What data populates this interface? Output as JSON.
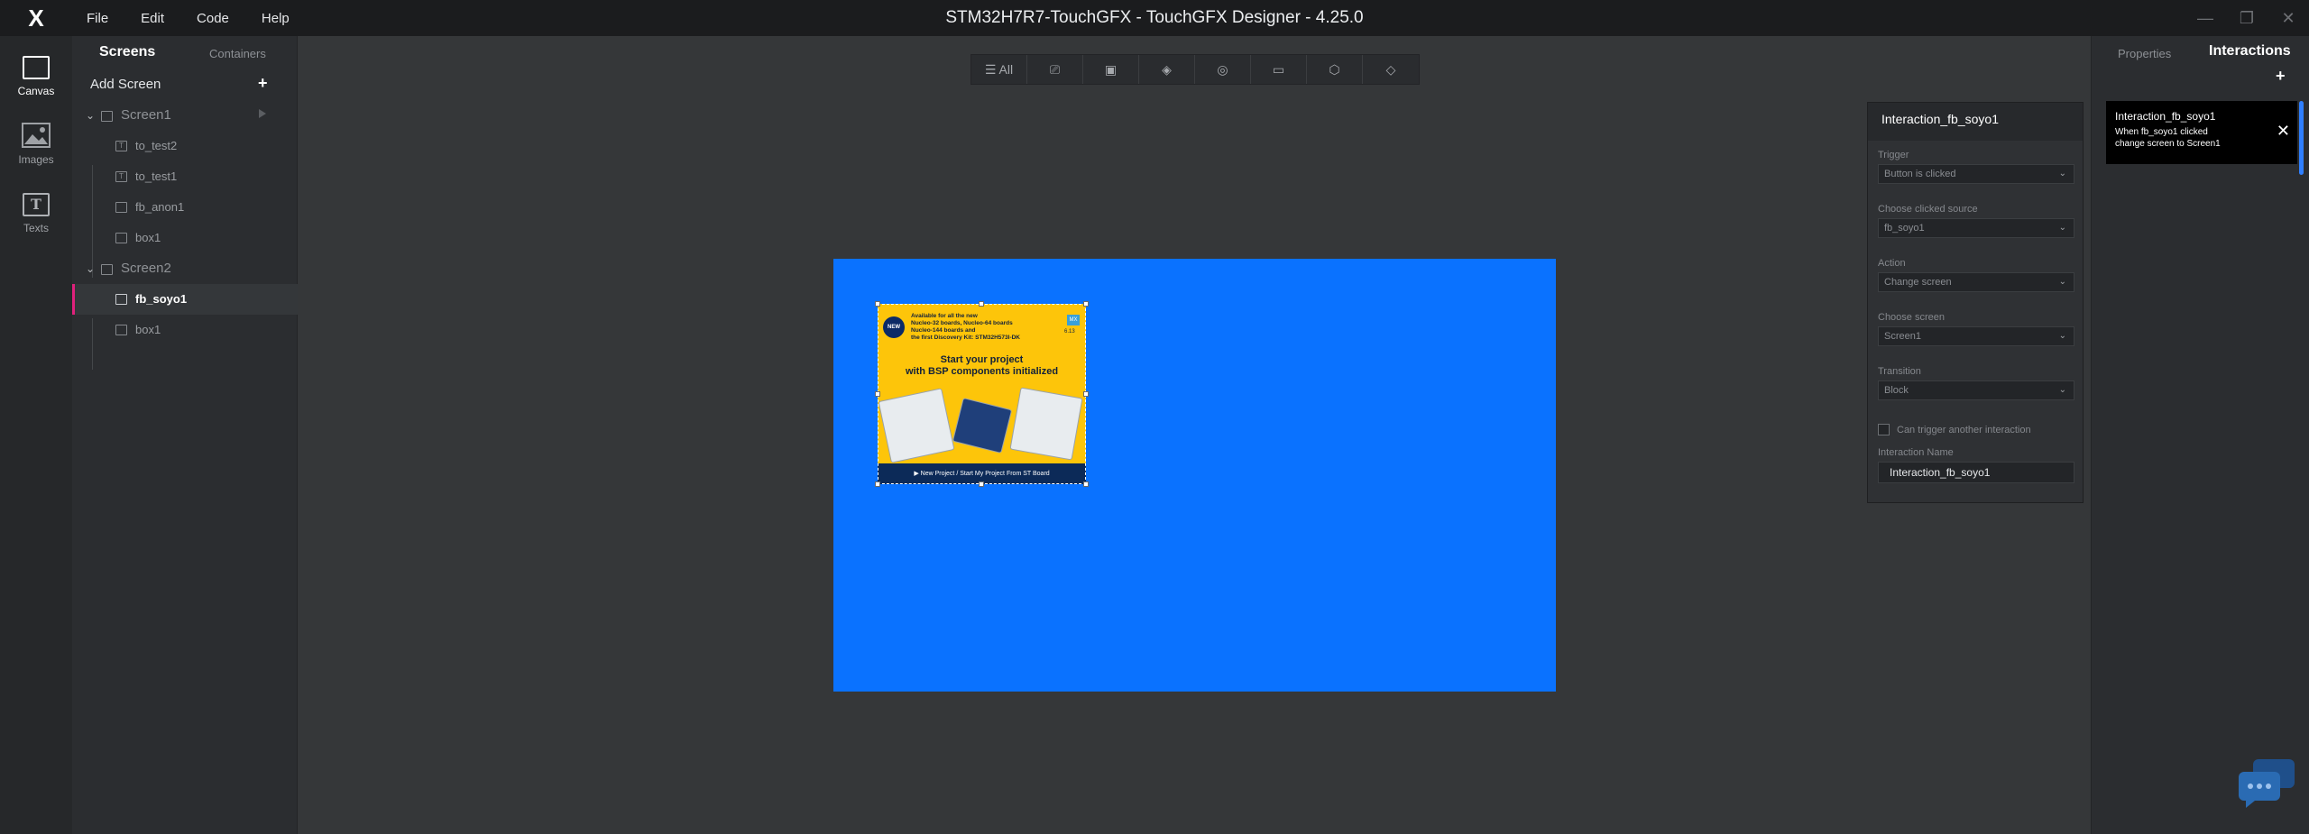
{
  "app": {
    "logo": "X",
    "title": "STM32H7R7-TouchGFX - TouchGFX Designer - 4.25.0",
    "menu": [
      "File",
      "Edit",
      "Code",
      "Help"
    ]
  },
  "rail": {
    "items": [
      {
        "label": "Canvas",
        "icon": "canvas-icon",
        "active": true
      },
      {
        "label": "Images",
        "icon": "images-icon",
        "active": false
      },
      {
        "label": "Texts",
        "icon": "texts-icon",
        "active": false
      }
    ],
    "texts_glyph": "T"
  },
  "screens_panel": {
    "tab_screens": "Screens",
    "tab_containers": "Containers",
    "add_screen": "Add Screen",
    "add_glyph": "+",
    "screen1": {
      "name": "Screen1",
      "children": [
        "to_test2",
        "to_test1",
        "fb_anon1",
        "box1"
      ]
    },
    "screen2": {
      "name": "Screen2",
      "children": [
        "fb_soyo1",
        "box1"
      ]
    }
  },
  "toolbar": {
    "all_label": "All",
    "items": [
      "interaction-icon",
      "image-icon",
      "layers-icon",
      "shapes-icon",
      "text-area-icon",
      "3d-box-icon",
      "stack-icon"
    ]
  },
  "canvas": {
    "background_color": "#0a72ff",
    "widget": {
      "badge": "NEW",
      "top_text": [
        "Available for all the new",
        "Nucleo-32 boards, Nucleo-64 boards",
        "Nucleo-144 boards and",
        "the first Discovery Kit: STM32H573I-DK"
      ],
      "tag": "MX",
      "version": "6.13",
      "headline": [
        "Start your project",
        "with BSP components initialized"
      ],
      "bottom_bar": "▶ New Project / Start My Project From ST Board"
    }
  },
  "interaction_popup": {
    "title": "Interaction_fb_soyo1",
    "trigger_label": "Trigger",
    "trigger_value": "Button is clicked",
    "source_label": "Choose clicked source",
    "source_value": "fb_soyo1",
    "action_label": "Action",
    "action_value": "Change screen",
    "screen_label": "Choose screen",
    "screen_value": "Screen1",
    "transition_label": "Transition",
    "transition_value": "Block",
    "can_trigger_label": "Can trigger another interaction",
    "can_trigger_checked": false,
    "name_label": "Interaction Name",
    "name_value": "Interaction_fb_soyo1"
  },
  "right_panel": {
    "tab_properties": "Properties",
    "tab_interactions": "Interactions",
    "add_glyph": "+",
    "card": {
      "title": "Interaction_fb_soyo1",
      "line1": "When fb_soyo1 clicked",
      "line2": "change screen to Screen1"
    }
  },
  "colors": {
    "accent_selected": "#e0217c",
    "canvas_blue": "#0a72ff",
    "widget_yellow": "#fdc50a"
  }
}
